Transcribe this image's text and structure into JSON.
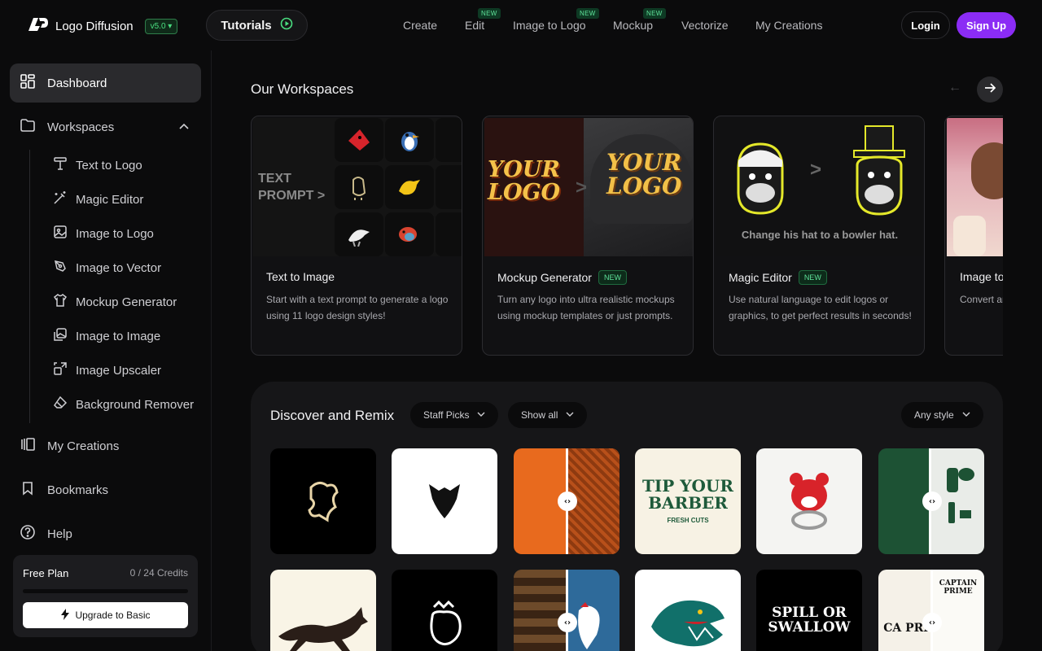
{
  "brand": {
    "name": "Logo Diffusion",
    "version": "v5.0"
  },
  "tutorials_label": "Tutorials",
  "nav": {
    "items": [
      {
        "label": "Create"
      },
      {
        "label": "Edit",
        "badge": "NEW"
      },
      {
        "label": "Image to Logo",
        "badge": "NEW"
      },
      {
        "label": "Mockup",
        "badge": "NEW"
      },
      {
        "label": "Vectorize"
      },
      {
        "label": "My Creations"
      }
    ]
  },
  "auth": {
    "login": "Login",
    "signup": "Sign Up"
  },
  "sidebar": {
    "dashboard": "Dashboard",
    "workspaces": "Workspaces",
    "sub_items": [
      "Text to Logo",
      "Magic Editor",
      "Image to Logo",
      "Image to Vector",
      "Mockup Generator",
      "Image to Image",
      "Image Upscaler",
      "Background Remover"
    ],
    "my_creations": "My Creations",
    "bookmarks": "Bookmarks",
    "help": "Help"
  },
  "plan": {
    "name": "Free Plan",
    "credits": "0 / 24 Credits",
    "credits_used_fraction": 0,
    "upgrade": "Upgrade to Basic"
  },
  "workspaces": {
    "title": "Our Workspaces",
    "cards": [
      {
        "title": "Text to Image",
        "badge": "",
        "desc": "Start with a text prompt to generate a logo using 11 logo design styles!",
        "img_text": "TEXT PROMPT >"
      },
      {
        "title": "Mockup Generator",
        "badge": "NEW",
        "desc": "Turn any logo into ultra realistic mockups using mockup templates or just prompts.",
        "img_text": "YOUR LOGO"
      },
      {
        "title": "Magic Editor",
        "badge": "NEW",
        "desc": "Use natural language to edit logos or graphics, to get perfect results in seconds!",
        "img_text": "Change his hat to a bowler hat."
      },
      {
        "title": "Image to",
        "badge": "",
        "desc": "Convert an logo desig",
        "img_text": ""
      }
    ]
  },
  "discover": {
    "title": "Discover and Remix",
    "filters": {
      "picks": "Staff Picks",
      "show": "Show all",
      "style": "Any style"
    },
    "tile_texts": [
      "TIP YOUR BARBER",
      "FRESH CUTS",
      "SPILL OR SWALLOW",
      "CAPTAIN PRIME"
    ]
  },
  "colors": {
    "accent": "#8b2cf5",
    "new_badge": "#5fe39a",
    "bg": "#0b0b0c"
  }
}
